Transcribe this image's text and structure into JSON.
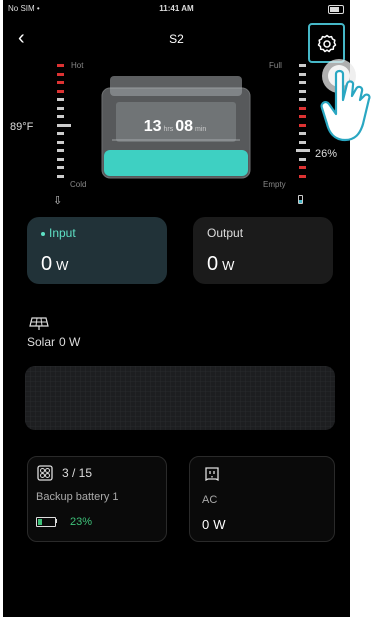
{
  "status_bar": {
    "carrier": "No SIM",
    "time": "11:41 AM"
  },
  "header": {
    "back_icon": "chevron-left-icon",
    "title": "S2",
    "settings_icon": "gear-icon"
  },
  "temperature_gauge": {
    "hot_label": "Hot",
    "cold_label": "Cold",
    "value": "89°F"
  },
  "battery_gauge": {
    "full_label": "Full",
    "empty_label": "Empty",
    "value": "26%"
  },
  "device": {
    "hours": "13",
    "hrs_label": "hrs",
    "minutes": "08",
    "min_label": "min"
  },
  "input_card": {
    "label": "Input",
    "value": "0",
    "unit": "W"
  },
  "output_card": {
    "label": "Output",
    "value": "0",
    "unit": "W"
  },
  "solar": {
    "label": "Solar",
    "value": "0",
    "unit": "W"
  },
  "backup": {
    "count": "3 / 15",
    "name": "Backup battery 1",
    "percent": "23%"
  },
  "ac": {
    "label": "AC",
    "value": "0",
    "unit": "W"
  },
  "colors": {
    "accent": "#5ee0c4",
    "highlight": "#46b8c8",
    "danger": "#d33333",
    "success": "#3ec27a"
  }
}
